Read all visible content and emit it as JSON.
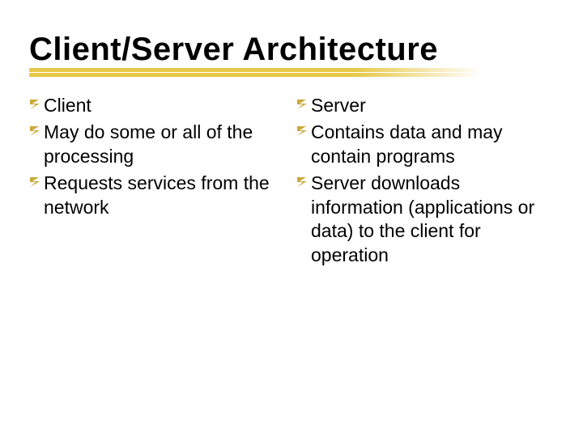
{
  "title": "Client/Server Architecture",
  "left": {
    "items": [
      "Client",
      "May do some or all of the processing",
      "Requests services from the network"
    ]
  },
  "right": {
    "items": [
      "Server",
      "Contains data and may contain programs",
      "Server downloads information (applications or data) to the client for operation"
    ]
  }
}
